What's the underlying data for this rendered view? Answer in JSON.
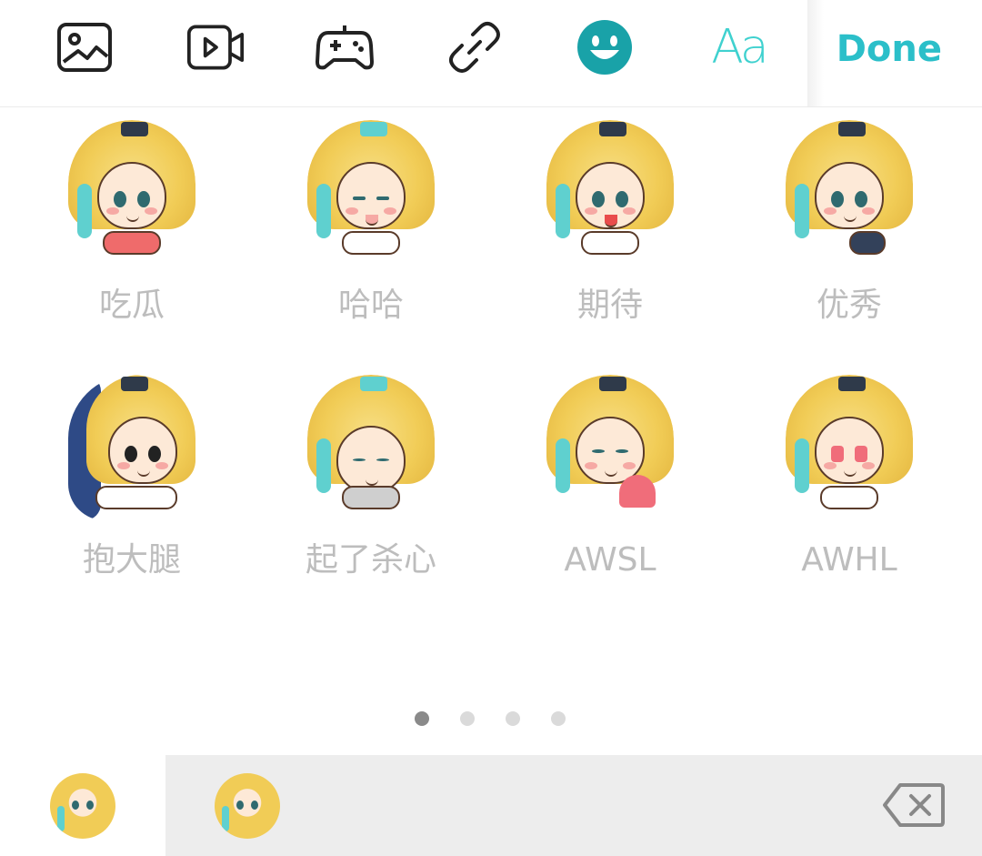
{
  "toolbar": {
    "icons": [
      "image-icon",
      "video-icon",
      "gamepad-icon",
      "link-icon",
      "emoji-icon",
      "text-style-icon"
    ],
    "text_style_label": "Aa",
    "done_label": "Done",
    "accent_color": "#2bbfc9"
  },
  "stickers": [
    {
      "label": "吃瓜"
    },
    {
      "label": "哈哈"
    },
    {
      "label": "期待"
    },
    {
      "label": "优秀"
    },
    {
      "label": "抱大腿"
    },
    {
      "label": "起了杀心"
    },
    {
      "label": "AWSL"
    },
    {
      "label": "AWHL"
    }
  ],
  "pager": {
    "pages": 4,
    "active_index": 0
  },
  "bottom_bar": {
    "packs": [
      "sticker-pack-1",
      "sticker-pack-2"
    ],
    "selected_pack": 0,
    "backspace_icon": "backspace-icon"
  }
}
